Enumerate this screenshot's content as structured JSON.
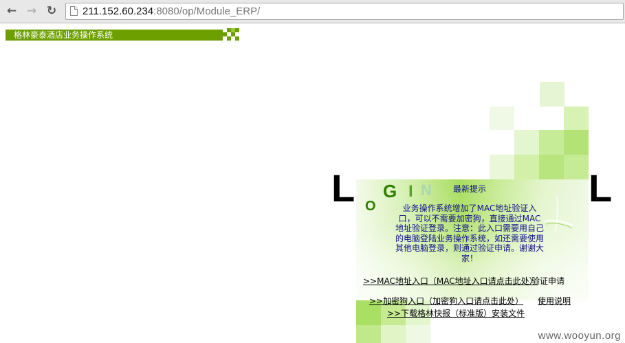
{
  "browser": {
    "url_host": "211.152.60.234",
    "url_rest": ":8080/op/Module_ERP/"
  },
  "header": {
    "title": "格林豪泰酒店业务操作系统"
  },
  "logo": {
    "letters": [
      "L",
      "O",
      "G",
      "I",
      "N",
      "L"
    ]
  },
  "notice": {
    "title": "最新提示",
    "body": "业务操作系统增加了MAC地址验证入口，可以不需要加密狗，直接通过MAC地址验证登录。注意：此入口需要用自己的电脑登陆业务操作系统，如还需要使用其他电脑登录，则通过验证申请。谢谢大家！"
  },
  "links": {
    "mac_entry": ">>MAC地址入口（MAC地址入口请点击此处）",
    "verify_apply": "验证申请",
    "dongle_entry": ">>加密狗入口（加密狗入口请点击此处）",
    "usage_guide": "使用说明",
    "download_client": ">>下载格林快报（标准版）安装文件"
  },
  "watermark": "www.wooyun.org",
  "colors": {
    "header_green": "#6e9f00",
    "notice_text": "#10108a"
  }
}
